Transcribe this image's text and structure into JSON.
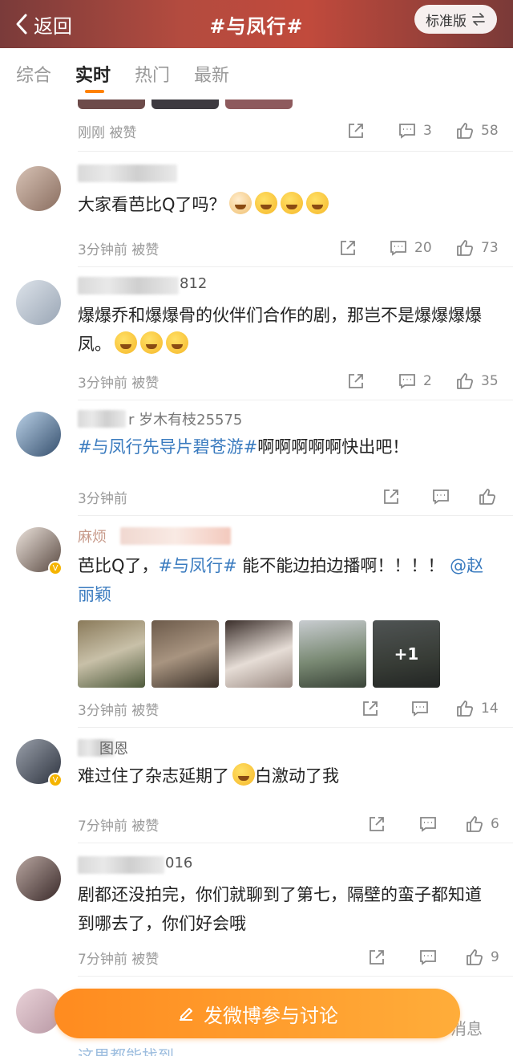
{
  "header": {
    "back_label": "返回",
    "title": "#与凤行#",
    "version_label": "标准版",
    "version_icon": "swap-icon"
  },
  "tabs": [
    {
      "label": "综合",
      "active": false
    },
    {
      "label": "实时",
      "active": true
    },
    {
      "label": "热门",
      "active": false
    },
    {
      "label": "最新",
      "active": false
    }
  ],
  "colors": {
    "accent": "#ff8200",
    "link": "#3a7bbf",
    "header_red": "#c14a3c"
  },
  "first_meta": {
    "time": "刚刚 被赞",
    "comments": "3",
    "likes": "58"
  },
  "posts": [
    {
      "username_suffix": "",
      "content": "大家看芭比Q了吗？",
      "time": "3分钟前 被赞",
      "comments": "20",
      "likes": "73"
    },
    {
      "username_suffix": "812",
      "content": "爆爆乔和爆爆骨的伙伴们合作的剧，那岂不是爆爆爆爆凤。",
      "time": "3分钟前 被赞",
      "comments": "2",
      "likes": "35"
    },
    {
      "username_suffix": "r 岁木有枝25575",
      "hashtag": "#与凤行先导片碧苍游#",
      "content_after": "啊啊啊啊啊快出吧！",
      "time": "3分钟前",
      "comments": "",
      "likes": ""
    },
    {
      "username_suffix": "麻烦",
      "content_before": "芭比Q了，",
      "hashtag": "#与凤行#",
      "content_mid": " 能不能边拍边播啊！！！！ ",
      "mention": "@赵丽颖",
      "images_more": "+1",
      "time": "3分钟前 被赞",
      "comments": "",
      "likes": "14"
    },
    {
      "username_suffix": "图恩",
      "content_before": "难过住了杂志延期了",
      "content_after": "白激动了我",
      "time": "7分钟前 被赞",
      "comments": "",
      "likes": "6"
    },
    {
      "username_suffix": "016",
      "content": "剧都还没拍完，你们就聊到了第七，隔壁的蛮子都知道到哪去了，你们好会哦",
      "time": "7分钟前 被赞",
      "comments": "",
      "likes": "9"
    }
  ],
  "cta": {
    "label": "发微博参与讨论",
    "icon": "pencil-icon"
  },
  "peek": {
    "right": "消息",
    "bottom": "这里都能找到"
  }
}
